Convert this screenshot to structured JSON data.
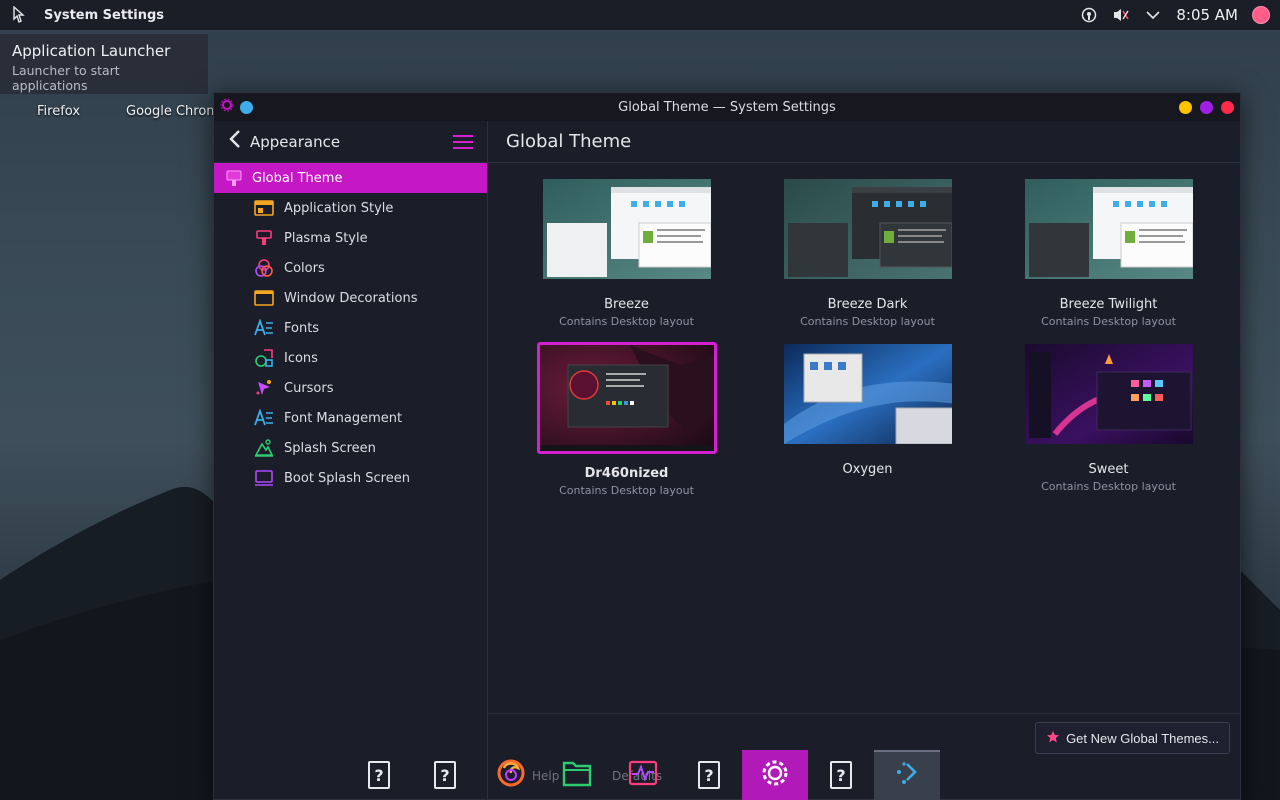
{
  "top_panel": {
    "app_title": "System Settings",
    "clock": "8:05 AM",
    "tray_icons": [
      "network-icon",
      "volume-muted-icon",
      "chevron-down-icon"
    ]
  },
  "launcher_tooltip": {
    "title": "Application Launcher",
    "subtitle": "Launcher to start applications"
  },
  "desktop_icons": [
    {
      "label": "Firefox"
    },
    {
      "label": "Google Chrom"
    }
  ],
  "window": {
    "title": "Global Theme — System Settings",
    "controls": {
      "minimize": "#ffc400",
      "maximize": "#a11ee6",
      "close": "#ff2a4a"
    }
  },
  "sidebar": {
    "header": "Appearance",
    "items": [
      {
        "label": "Global Theme",
        "icon": "global-theme-icon",
        "active": true
      },
      {
        "label": "Application Style",
        "icon": "application-style-icon"
      },
      {
        "label": "Plasma Style",
        "icon": "plasma-style-icon"
      },
      {
        "label": "Colors",
        "icon": "colors-icon"
      },
      {
        "label": "Window Decorations",
        "icon": "window-decorations-icon"
      },
      {
        "label": "Fonts",
        "icon": "fonts-icon"
      },
      {
        "label": "Icons",
        "icon": "icons-icon"
      },
      {
        "label": "Cursors",
        "icon": "cursors-icon"
      },
      {
        "label": "Font Management",
        "icon": "font-management-icon"
      },
      {
        "label": "Splash Screen",
        "icon": "splash-screen-icon"
      },
      {
        "label": "Boot Splash Screen",
        "icon": "boot-splash-screen-icon"
      }
    ]
  },
  "main": {
    "title": "Global Theme",
    "themes": [
      {
        "name": "Breeze",
        "sub": "Contains Desktop layout",
        "style": "light"
      },
      {
        "name": "Breeze Dark",
        "sub": "Contains Desktop layout",
        "style": "dark"
      },
      {
        "name": "Breeze Twilight",
        "sub": "Contains Desktop layout",
        "style": "twilight"
      },
      {
        "name": "Dr460nized",
        "sub": "Contains Desktop layout",
        "style": "dragon",
        "selected": true
      },
      {
        "name": "Oxygen",
        "sub": "",
        "style": "oxygen"
      },
      {
        "name": "Sweet",
        "sub": "Contains Desktop layout",
        "style": "sweet"
      }
    ],
    "get_new_label": "Get New Global Themes...",
    "footer_hidden": {
      "help": "Help",
      "defaults": "Defaults"
    }
  },
  "taskbar": {
    "tasks": [
      {
        "icon": "unknown-app-icon"
      },
      {
        "icon": "unknown-app-icon"
      },
      {
        "icon": "firefox-icon"
      },
      {
        "icon": "file-manager-icon"
      },
      {
        "icon": "system-monitor-icon"
      },
      {
        "icon": "unknown-app-icon"
      },
      {
        "icon": "system-settings-icon",
        "active": "purple"
      },
      {
        "icon": "unknown-app-icon"
      },
      {
        "icon": "kde-connect-icon",
        "active": "gray"
      }
    ]
  },
  "colors": {
    "accent": "#c418c4",
    "window_bg": "#1b1d29"
  }
}
